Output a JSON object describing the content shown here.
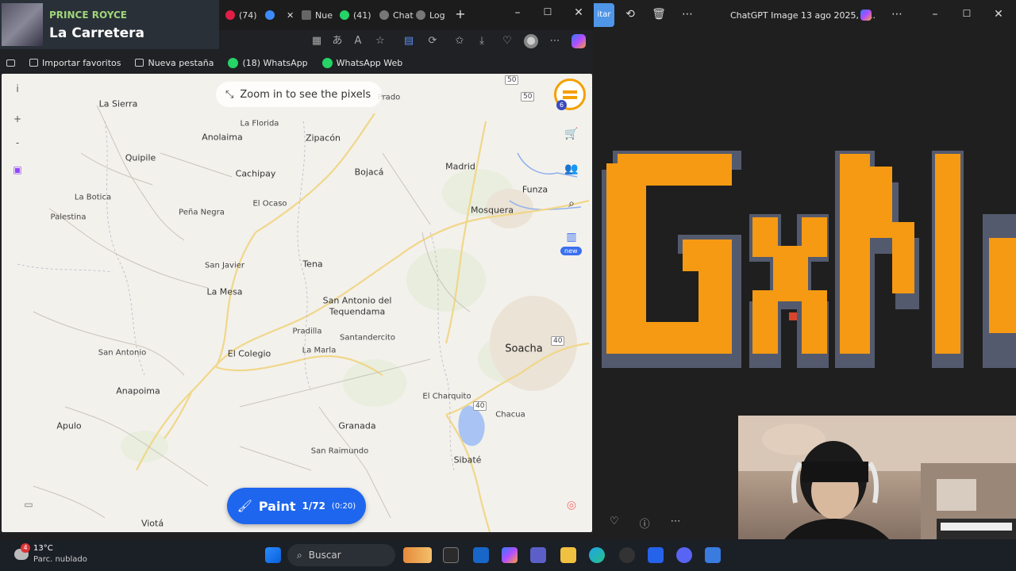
{
  "now_playing": {
    "artist": "PRINCE ROYCE",
    "song": "La Carretera"
  },
  "tabs": [
    {
      "label": "(74)",
      "color": "#e01e48"
    },
    {
      "label": "",
      "color": "#3d8bfd"
    },
    {
      "label": "Nue",
      "color": "#888888"
    },
    {
      "label": "(41)",
      "color": "#25d366"
    },
    {
      "label": "Chat",
      "color": "#888888"
    },
    {
      "label": "Log",
      "color": "#888888"
    }
  ],
  "bookmarks": [
    {
      "label": "Importar favoritos",
      "icon": "import-icon"
    },
    {
      "label": "Nueva pestaña",
      "icon": "tab-icon"
    },
    {
      "label": "(18) WhatsApp",
      "icon": "whatsapp-icon"
    },
    {
      "label": "WhatsApp Web",
      "icon": "whatsapp-icon"
    }
  ],
  "map": {
    "zoom_hint": "Zoom in to see the pixels",
    "towns": [
      {
        "name": "La Sierra",
        "size": "normal"
      },
      {
        "name": "La Florida",
        "size": "small"
      },
      {
        "name": "Anolaima",
        "size": "normal"
      },
      {
        "name": "Zipacón",
        "size": "normal"
      },
      {
        "name": "Quipile",
        "size": "normal"
      },
      {
        "name": "Cachipay",
        "size": "normal"
      },
      {
        "name": "Bojacá",
        "size": "normal"
      },
      {
        "name": "Madrid",
        "size": "normal"
      },
      {
        "name": "Funza",
        "size": "normal"
      },
      {
        "name": "La Botica",
        "size": "small"
      },
      {
        "name": "El Ocaso",
        "size": "small"
      },
      {
        "name": "Mosquera",
        "size": "normal"
      },
      {
        "name": "Palestina",
        "size": "small"
      },
      {
        "name": "Peña Negra",
        "size": "small"
      },
      {
        "name": "San Javier",
        "size": "small"
      },
      {
        "name": "Tena",
        "size": "normal"
      },
      {
        "name": "La Mesa",
        "size": "normal"
      },
      {
        "name": "San Antonio del",
        "size": "normal"
      },
      {
        "name": "Tequendama",
        "size": "normal"
      },
      {
        "name": "Pradilla",
        "size": "small"
      },
      {
        "name": "Santandercito",
        "size": "small"
      },
      {
        "name": "San Antonio",
        "size": "small"
      },
      {
        "name": "El Colegio",
        "size": "normal"
      },
      {
        "name": "La Marla",
        "size": "small"
      },
      {
        "name": "Soacha",
        "size": "bigger"
      },
      {
        "name": "Anapoima",
        "size": "normal"
      },
      {
        "name": "El Charquito",
        "size": "small"
      },
      {
        "name": "Chacua",
        "size": "small"
      },
      {
        "name": "Apulo",
        "size": "normal"
      },
      {
        "name": "Granada",
        "size": "normal"
      },
      {
        "name": "San Raimundo",
        "size": "small"
      },
      {
        "name": "Sibaté",
        "size": "normal"
      },
      {
        "name": "Viotá",
        "size": "normal"
      },
      {
        "name": "Prado",
        "size": "small"
      }
    ],
    "shields": [
      "50",
      "50",
      "40",
      "40"
    ],
    "new_badge": "new",
    "user_level": "6",
    "paint": {
      "label": "Paint",
      "count": "1/72",
      "time": "(0:20)"
    }
  },
  "photos": {
    "title": "ChatGPT Image 13 ago 2025, 1...",
    "edit_label": "itar",
    "pixel_text": "GxN"
  },
  "taskbar": {
    "temp": "13°C",
    "weather": "Parc. nublado",
    "notif_count": "4",
    "search_placeholder": "Buscar"
  },
  "colors": {
    "accent": "#1e66ee",
    "pixel_orange": "#f59a12",
    "pixel_shadow": "#545a6e"
  }
}
